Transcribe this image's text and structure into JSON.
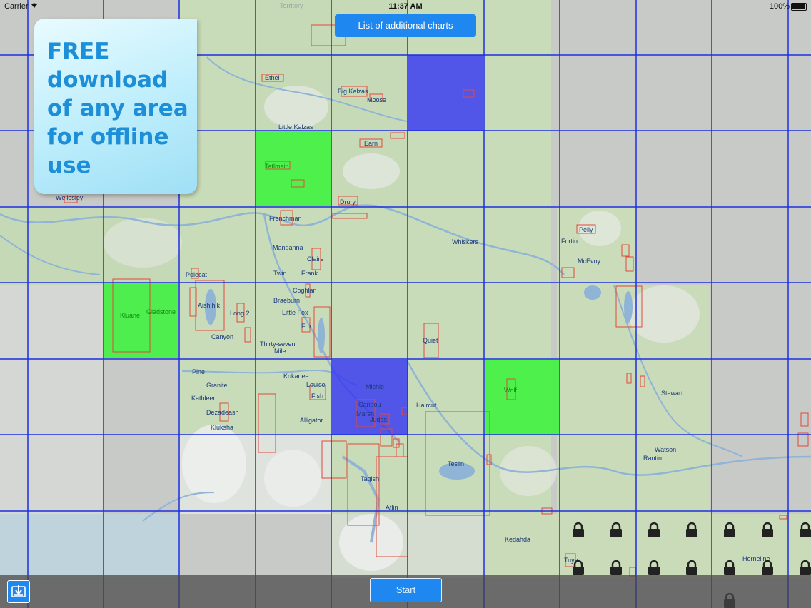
{
  "status_bar": {
    "carrier": "Carrier",
    "time": "11:37 AM",
    "battery": "100%"
  },
  "promo": {
    "text": "FREE download of any area for offline use"
  },
  "top_button": {
    "label": "List of additional charts"
  },
  "bottom_bar": {
    "start_label": "Start",
    "download_icon": "download-tray-icon"
  },
  "grid": {
    "columns": 11,
    "rows": 8,
    "line_color": "#1d2fe0",
    "selected_blue": [
      [
        5,
        0
      ],
      [
        4,
        4
      ]
    ],
    "selected_green": [
      [
        3,
        1
      ],
      [
        1,
        3
      ],
      [
        6,
        4
      ]
    ],
    "locked_cells_icon": "lock-icon"
  },
  "map_labels": [
    {
      "id": "territory",
      "text": "Territory"
    },
    {
      "id": "ethel",
      "text": "Ethel"
    },
    {
      "id": "big-kalzas",
      "text": "Big Kalzas"
    },
    {
      "id": "moose",
      "text": "Moose"
    },
    {
      "id": "little-kalzas",
      "text": "Little Kalzas"
    },
    {
      "id": "earn",
      "text": "Earn"
    },
    {
      "id": "tatlmain",
      "text": "Tatlmain"
    },
    {
      "id": "drury",
      "text": "Drury"
    },
    {
      "id": "wellesley",
      "text": "Wellesley"
    },
    {
      "id": "frenchman",
      "text": "Frenchman"
    },
    {
      "id": "mandanna",
      "text": "Mandanna"
    },
    {
      "id": "claire",
      "text": "Claire"
    },
    {
      "id": "twin",
      "text": "Twin"
    },
    {
      "id": "frank",
      "text": "Frank"
    },
    {
      "id": "polecat",
      "text": "Polecat"
    },
    {
      "id": "coghlan",
      "text": "Coghlan"
    },
    {
      "id": "braeburn",
      "text": "Braeburn"
    },
    {
      "id": "little-fox",
      "text": "Little Fox"
    },
    {
      "id": "fox",
      "text": "Fox"
    },
    {
      "id": "aishihik",
      "text": "Aishihik"
    },
    {
      "id": "long-2",
      "text": "Long 2"
    },
    {
      "id": "kluane",
      "text": "Kluane"
    },
    {
      "id": "gladstone",
      "text": "Gladstone"
    },
    {
      "id": "canyon",
      "text": "Canyon"
    },
    {
      "id": "thirty-seven",
      "text": "Thirty-seven"
    },
    {
      "id": "mile",
      "text": "Mile"
    },
    {
      "id": "whiskers",
      "text": "Whiskers"
    },
    {
      "id": "pelly",
      "text": "Pelly"
    },
    {
      "id": "fortin",
      "text": "Fortin"
    },
    {
      "id": "mcevoy",
      "text": "McEvoy"
    },
    {
      "id": "quiet",
      "text": "Quiet"
    },
    {
      "id": "pine",
      "text": "Pine"
    },
    {
      "id": "kokanee",
      "text": "Kokanee"
    },
    {
      "id": "granite",
      "text": "Granite"
    },
    {
      "id": "louise",
      "text": "Louise"
    },
    {
      "id": "michie",
      "text": "Michie"
    },
    {
      "id": "fish",
      "text": "Fish"
    },
    {
      "id": "kathleen",
      "text": "Kathleen"
    },
    {
      "id": "caribou",
      "text": "Caribou"
    },
    {
      "id": "haircut",
      "text": "Haircut"
    },
    {
      "id": "marsh",
      "text": "Marsh"
    },
    {
      "id": "judas",
      "text": "Judas"
    },
    {
      "id": "dezadeash",
      "text": "Dezadeash"
    },
    {
      "id": "alligator",
      "text": "Alligator"
    },
    {
      "id": "kluksha",
      "text": "Kluksha"
    },
    {
      "id": "wolf",
      "text": "Wolf"
    },
    {
      "id": "stewart",
      "text": "Stewart"
    },
    {
      "id": "watson",
      "text": "Watson"
    },
    {
      "id": "rantin",
      "text": "Rantin"
    },
    {
      "id": "teslin",
      "text": "Teslin"
    },
    {
      "id": "tagish",
      "text": "Tagish"
    },
    {
      "id": "atlin",
      "text": "Atlin"
    },
    {
      "id": "kedahda",
      "text": "Kedahda"
    },
    {
      "id": "tuya",
      "text": "Tuya"
    },
    {
      "id": "horneline",
      "text": "Horneline"
    }
  ]
}
